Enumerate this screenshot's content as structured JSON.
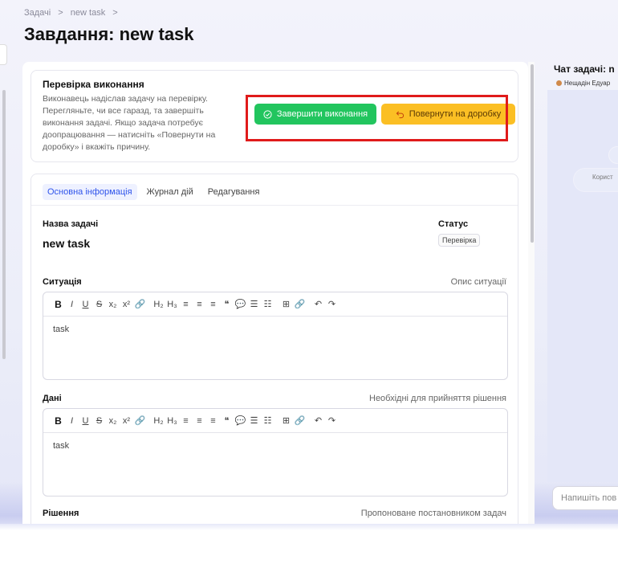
{
  "breadcrumb": {
    "items": [
      "Задачі",
      "new task"
    ],
    "sep": ">"
  },
  "page": {
    "title": "Завдання: new task"
  },
  "review": {
    "title": "Перевірка виконання",
    "description": "Виконавець надіслав задачу на перевірку. Перегляньте, чи все гаразд, та завершіть виконання задачі. Якщо задача потребує доопрацювання — натисніть «Повернути на доробку» і вкажіть причину.",
    "complete_label": "Завершити виконання",
    "return_label": "Повернути на доробку"
  },
  "tabs": [
    {
      "label": "Основна інформація",
      "active": true
    },
    {
      "label": "Журнал дій",
      "active": false
    },
    {
      "label": "Редагування",
      "active": false
    }
  ],
  "task": {
    "name_label": "Назва задачі",
    "name": "new task",
    "status_label": "Статус",
    "status": "Перевірка"
  },
  "situation": {
    "label": "Ситуація",
    "hint": "Опис ситуації",
    "content": "task"
  },
  "data_field": {
    "label": "Дані",
    "hint": "Необхідні для прийняття рішення",
    "content": "task"
  },
  "solution": {
    "label": "Рішення",
    "hint": "Пропоноване постановником задач"
  },
  "toolbar": [
    "B",
    "I",
    "U",
    "S",
    "x₂",
    "x²",
    "🔗",
    "H₂",
    "H₃",
    "≡",
    "≡",
    "≡",
    "❝",
    "💬",
    "☰",
    "☷",
    "⊞",
    "🔗",
    "↶",
    "↷"
  ],
  "chat": {
    "title": "Чат задачі: n",
    "user": "Нещадін Едуар",
    "ghost_text": "Корист",
    "input_placeholder": "Напишіть пов"
  },
  "colors": {
    "accent": "#2f54eb",
    "complete": "#22c55e",
    "return": "#fbbf24",
    "highlight": "#e01b1b"
  }
}
